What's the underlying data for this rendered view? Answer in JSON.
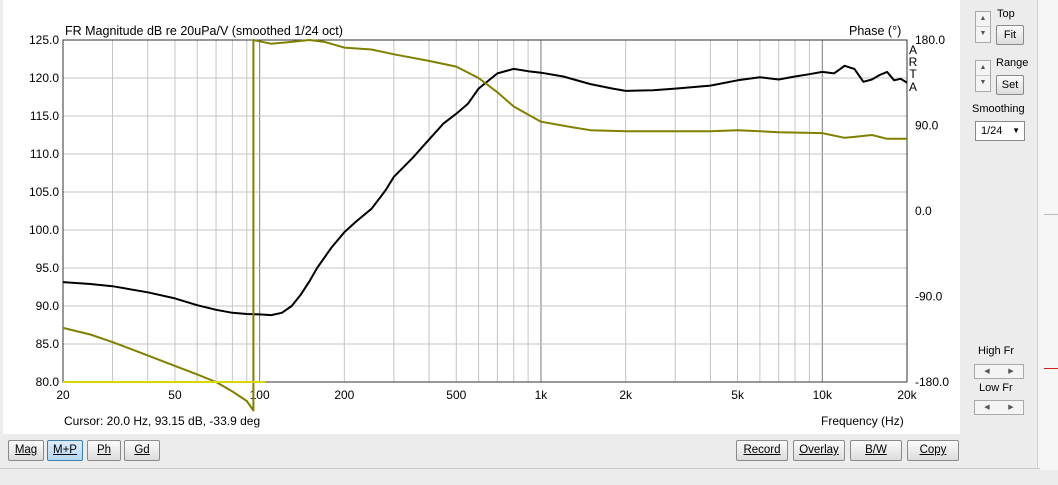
{
  "chart_data": {
    "type": "line",
    "title": "FR Magnitude dB re 20uPa/V (smoothed 1/24 oct)",
    "y2_title": "Phase (°)",
    "xlabel": "Frequency (Hz)",
    "x_scale": "log",
    "xlim": [
      20,
      20000
    ],
    "ylim": [
      80,
      125
    ],
    "y2lim": [
      -180,
      180
    ],
    "x_ticks": [
      20,
      50,
      100,
      200,
      500,
      1000,
      2000,
      5000,
      10000,
      20000
    ],
    "x_tick_labels": [
      "20",
      "50",
      "100",
      "200",
      "500",
      "1k",
      "2k",
      "5k",
      "10k",
      "20k"
    ],
    "y_tick_labels": [
      "125.0",
      "120.0",
      "115.0",
      "110.0",
      "105.0",
      "100.0",
      "95.0",
      "90.0",
      "85.0",
      "80.0"
    ],
    "y2_tick_labels": [
      "180.0",
      "90.0",
      "0.0",
      "-90.0",
      "-180.0"
    ],
    "grid": true,
    "series": [
      {
        "name": "Magnitude (dB)",
        "color": "#000000",
        "axis": "left",
        "x": [
          20,
          25,
          30,
          40,
          50,
          60,
          70,
          80,
          90,
          100,
          110,
          120,
          130,
          140,
          150,
          160,
          180,
          200,
          220,
          250,
          280,
          300,
          350,
          400,
          450,
          500,
          550,
          600,
          700,
          800,
          900,
          1000,
          1200,
          1500,
          1800,
          2000,
          2500,
          3000,
          4000,
          5000,
          6000,
          7000,
          8000,
          9000,
          10000,
          11000,
          12000,
          13000,
          14000,
          15000,
          16000,
          17000,
          18000,
          19000,
          20000
        ],
        "y": [
          93.15,
          92.9,
          92.6,
          91.8,
          91.0,
          90.1,
          89.5,
          89.1,
          88.95,
          88.9,
          88.8,
          89.1,
          90.0,
          91.5,
          93.2,
          95.0,
          97.7,
          99.7,
          101.1,
          102.8,
          105.2,
          107.0,
          109.5,
          111.9,
          114.0,
          115.3,
          116.6,
          118.6,
          120.6,
          121.2,
          120.9,
          120.7,
          120.2,
          119.2,
          118.6,
          118.3,
          118.4,
          118.6,
          119.0,
          119.7,
          120.1,
          119.8,
          120.2,
          120.5,
          120.8,
          120.6,
          121.6,
          121.2,
          119.5,
          119.8,
          120.4,
          120.8,
          119.7,
          119.9,
          119.4
        ]
      },
      {
        "name": "Phase (°)",
        "color": "#808000",
        "axis": "right",
        "x": [
          20,
          25,
          30,
          40,
          50,
          60,
          70,
          80,
          90,
          95,
          95,
          110,
          130,
          150,
          170,
          200,
          250,
          300,
          400,
          500,
          600,
          700,
          800,
          1000,
          1300,
          1500,
          2000,
          3000,
          4000,
          5000,
          7000,
          10000,
          12000,
          13000,
          15000,
          17000,
          20000
        ],
        "y": [
          -123,
          -130,
          -138,
          -152,
          -163,
          -172,
          -180,
          -190,
          -200,
          -210,
          180,
          176,
          178,
          180,
          178,
          172,
          170,
          165,
          158,
          152,
          140,
          125,
          110,
          94,
          88,
          85,
          84,
          84,
          84,
          85,
          83,
          82,
          77,
          78,
          80,
          76,
          76
        ]
      },
      {
        "name": "Low cut marker",
        "color": "#d8d800",
        "axis": "right",
        "x": [
          20,
          105
        ],
        "y": [
          -180,
          -180
        ]
      }
    ]
  },
  "cursor_readout": "Cursor: 20.0 Hz, 93.15 dB, -33.9 deg",
  "arta_label": [
    "A",
    "R",
    "T",
    "A"
  ],
  "right_panel": {
    "top_label": "Top",
    "fit_label": "Fit",
    "range_label": "Range",
    "set_label": "Set",
    "smoothing_label": "Smoothing",
    "smoothing_value": "1/24",
    "high_fr_label": "High Fr",
    "low_fr_label": "Low Fr"
  },
  "toolbar": {
    "mag_label": "Mag",
    "mp_label": "M+P",
    "ph_label": "Ph",
    "gd_label": "Gd",
    "record_label": "Record",
    "overlay_label": "Overlay",
    "bw_label": "B/W",
    "copy_label": "Copy"
  }
}
